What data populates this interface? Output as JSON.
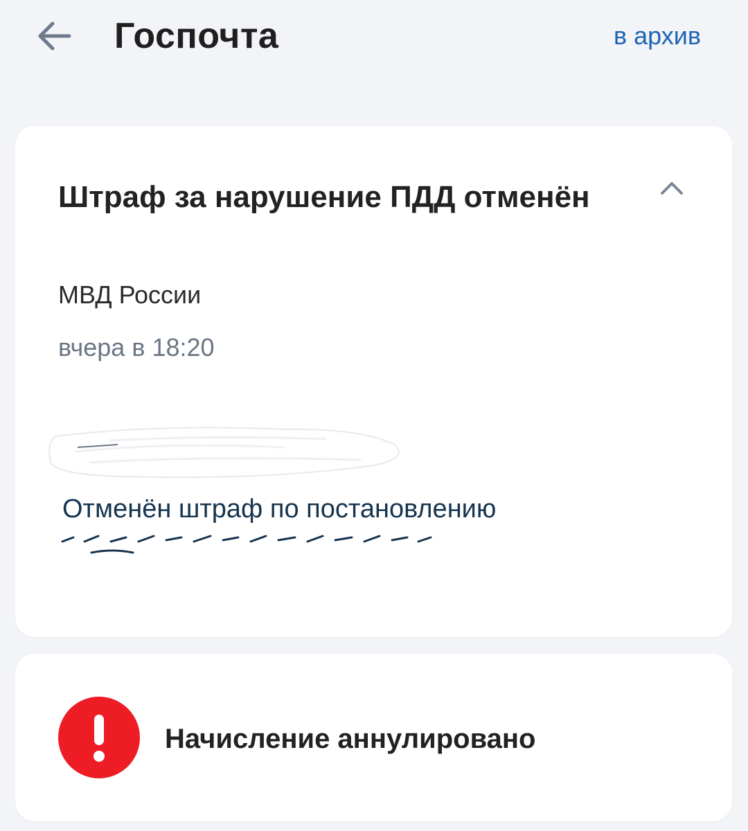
{
  "header": {
    "title": "Госпочта",
    "archive_label": "в архив",
    "back_icon": "arrow-left-icon"
  },
  "message": {
    "title": "Штраф за нарушение ПДД отменён",
    "sender": "МВД России",
    "time": "вчера в 18:20",
    "body": "Отменён штраф по постановлению",
    "collapse_icon": "chevron-up-icon"
  },
  "status": {
    "icon": "alert-circle-icon",
    "icon_color": "#ee1c25",
    "text": "Начисление аннулировано"
  },
  "colors": {
    "background": "#f2f4f7",
    "card": "#ffffff",
    "link": "#1e64b4"
  }
}
